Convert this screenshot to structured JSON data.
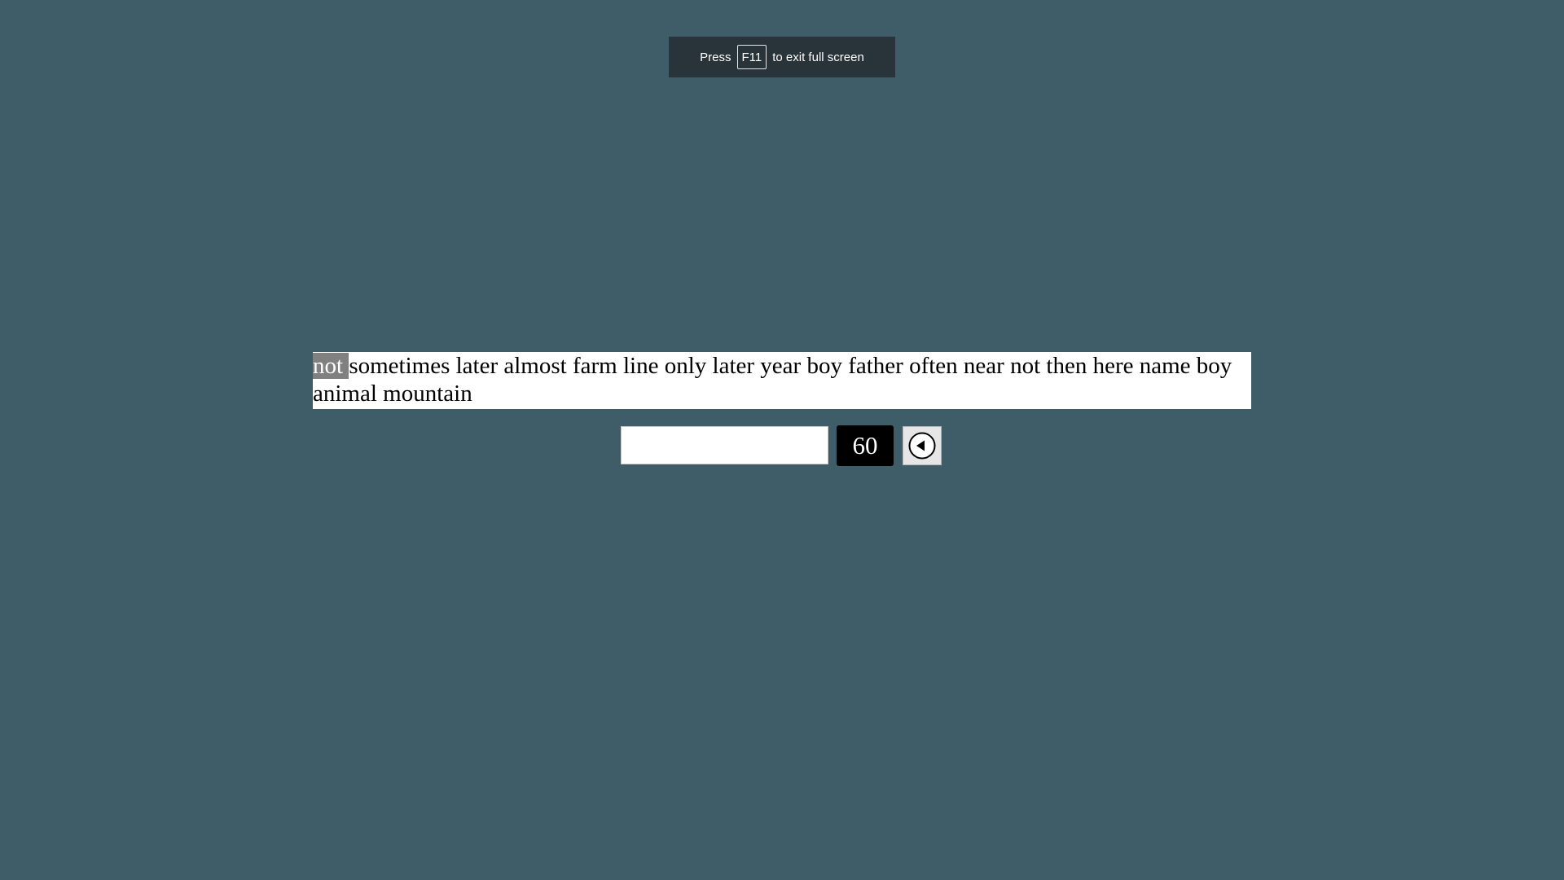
{
  "fullscreen_notice": {
    "prefix": "Press",
    "key": "F11",
    "suffix": "to exit full screen"
  },
  "typing_test": {
    "words": [
      "not",
      "sometimes",
      "later",
      "almost",
      "farm",
      "line",
      "only",
      "later",
      "year",
      "boy",
      "father",
      "often",
      "near",
      "not",
      "then",
      "here",
      "name",
      "boy",
      "animal",
      "mountain"
    ],
    "current_word_index": 0,
    "input_value": "",
    "timer_value": "60",
    "restart_icon": "circle-left-arrow-icon"
  },
  "colors": {
    "background": "#3f5d69",
    "highlight": "#808080",
    "timer_bg": "#000000",
    "notice_bg": "#28343a"
  }
}
